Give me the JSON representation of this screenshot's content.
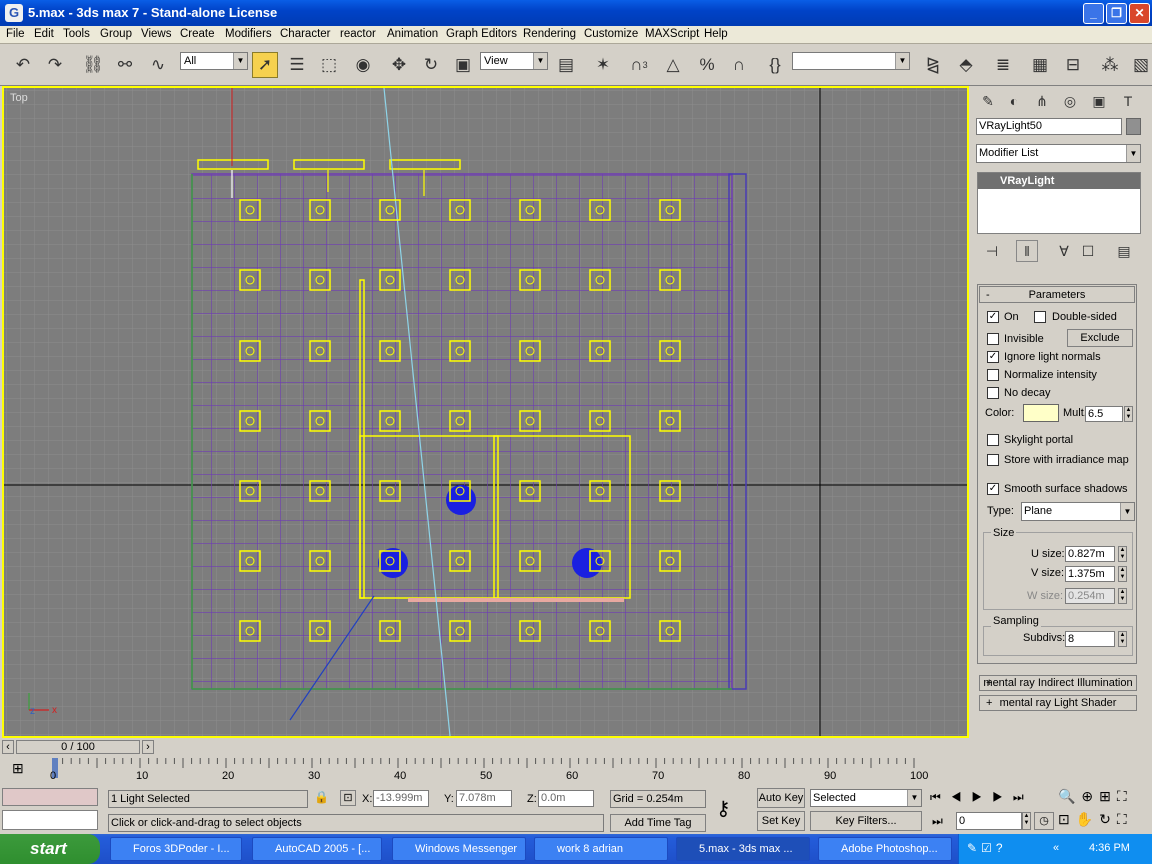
{
  "window": {
    "title": "5.max - 3ds max 7  - Stand-alone License",
    "app_icon": "G"
  },
  "menu": [
    "File",
    "Edit",
    "Tools",
    "Group",
    "Views",
    "Create",
    "Modifiers",
    "Character",
    "reactor",
    "Animation",
    "Graph Editors",
    "Rendering",
    "Customize",
    "MAXScript",
    "Help"
  ],
  "toolbar": {
    "selection_filter": "All",
    "ref_coord": "View",
    "named_selection": "",
    "snap_value": "3"
  },
  "viewport": {
    "label": "Top",
    "axis_x": "x",
    "axis_z": "z"
  },
  "command_panel": {
    "object_name": "VRayLight50",
    "modifier_list": "Modifier List",
    "stack_item": "VRayLight",
    "parameters_title": "Parameters",
    "on_label": "On",
    "on": true,
    "double_sided_label": "Double-sided",
    "double_sided": false,
    "invisible_label": "Invisible",
    "invisible": false,
    "exclude_label": "Exclude",
    "ignore_normals_label": "Ignore light normals",
    "ignore_normals": true,
    "normalize_label": "Normalize intensity",
    "normalize": false,
    "no_decay_label": "No decay",
    "no_decay": false,
    "color_label": "Color:",
    "color": "#ffffc8",
    "mult_label": "Mult.",
    "mult": "6.5",
    "skylight_label": "Skylight portal",
    "skylight": false,
    "store_irr_label": "Store with irradiance map",
    "store_irr": false,
    "smooth_label": "Smooth surface shadows",
    "smooth": true,
    "type_label": "Type:",
    "type": "Plane",
    "size_title": "Size",
    "u_label": "U size:",
    "u": "0.827m",
    "v_label": "V size:",
    "v": "1.375m",
    "w_label": "W size:",
    "w": "0.254m",
    "sampling_title": "Sampling",
    "subdivs_label": "Subdivs:",
    "subdivs": "8",
    "rollout_mr_indirect": "mental ray Indirect Illumination",
    "rollout_mr_shader": "mental ray Light Shader"
  },
  "timeline": {
    "frame": "0 / 100",
    "ticks": [
      "0",
      "10",
      "20",
      "30",
      "40",
      "50",
      "60",
      "70",
      "80",
      "90",
      "100"
    ]
  },
  "status": {
    "selected": "1 Light Selected",
    "prompt": "Click or click-and-drag to select objects",
    "x_label": "X:",
    "x": "-13.999m",
    "y_label": "Y:",
    "y": "7.078m",
    "z_label": "Z:",
    "z": "0.0m",
    "grid": "Grid = 0.254m",
    "add_time_tag": "Add Time Tag",
    "auto_key": "Auto Key",
    "set_key": "Set Key",
    "key_mode": "Selected",
    "key_filters": "Key Filters...",
    "current_frame": "0"
  },
  "taskbar": {
    "start": "start",
    "tasks": [
      "Foros 3DPoder - I...",
      "AutoCAD 2005 - [...",
      "Windows Messenger",
      "work 8 adrian",
      "5.max - 3ds max ...",
      "Adobe Photoshop..."
    ],
    "clock": "4:36 PM"
  }
}
